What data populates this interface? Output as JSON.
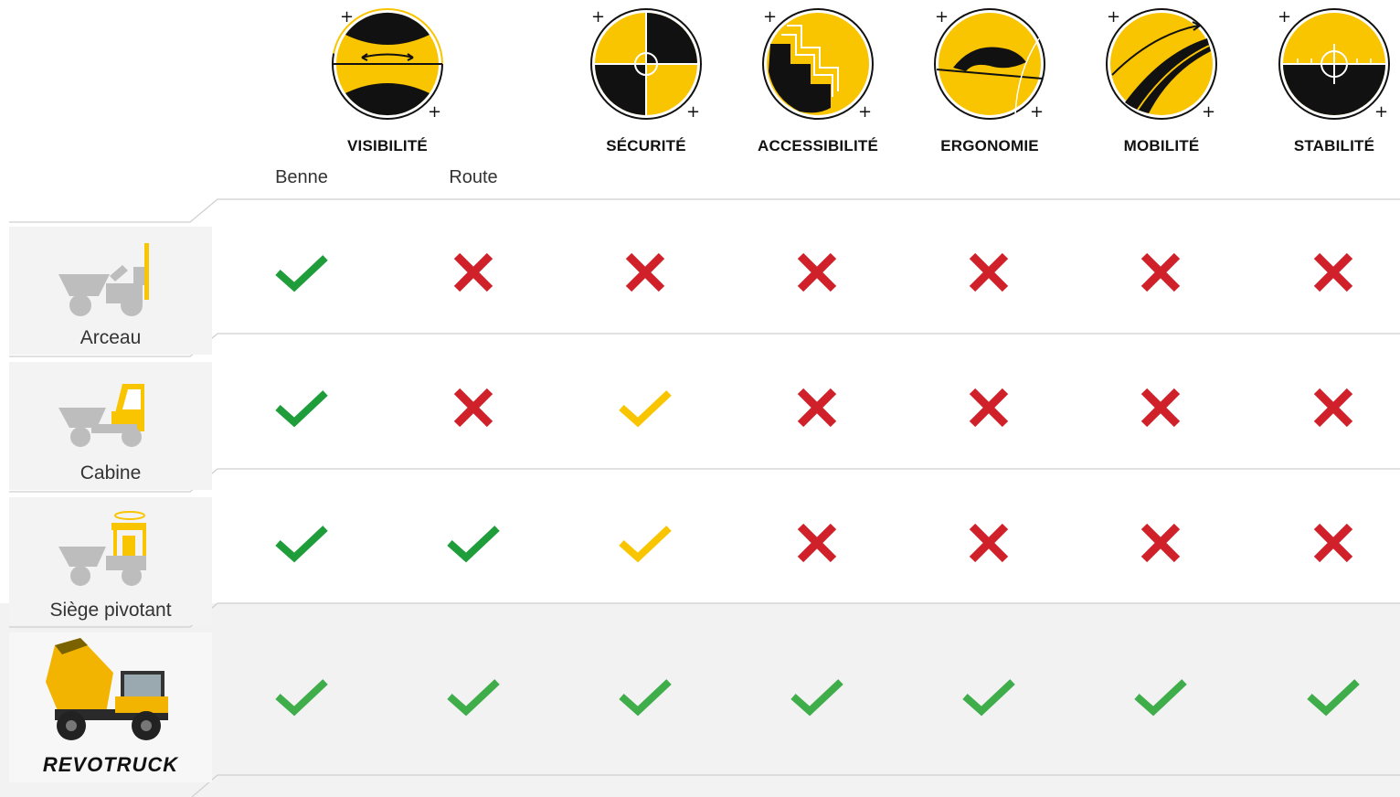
{
  "criteria": [
    {
      "key": "visibility",
      "label": "VISIBILITÉ",
      "icon": "visibility-icon"
    },
    {
      "key": "safety",
      "label": "SÉCURITÉ",
      "icon": "safety-icon"
    },
    {
      "key": "accessibility",
      "label": "ACCESSIBILITÉ",
      "icon": "accessibility-icon"
    },
    {
      "key": "ergonomics",
      "label": "ERGONOMIE",
      "icon": "ergonomics-icon"
    },
    {
      "key": "mobility",
      "label": "MOBILITÉ",
      "icon": "mobility-icon"
    },
    {
      "key": "stability",
      "label": "STABILITÉ",
      "icon": "stability-icon"
    }
  ],
  "visibility_sub": {
    "benne": "Benne",
    "route": "Route"
  },
  "rows": [
    {
      "name": "Arceau",
      "icon": "dumper-rollbar-icon",
      "marks": [
        "check-green",
        "cross",
        "cross",
        "cross",
        "cross",
        "cross",
        "cross"
      ]
    },
    {
      "name": "Cabine",
      "icon": "dumper-cab-icon",
      "marks": [
        "check-green",
        "cross",
        "check-yellow",
        "cross",
        "cross",
        "cross",
        "cross"
      ]
    },
    {
      "name": "Siège pivotant",
      "icon": "dumper-swivel-seat-icon",
      "marks": [
        "check-green",
        "check-green",
        "check-yellow",
        "cross",
        "cross",
        "cross",
        "cross"
      ]
    },
    {
      "name": "REVOTRUCK",
      "icon": "revotruck-photo",
      "marks": [
        "check-green",
        "check-green",
        "check-green",
        "check-green",
        "check-green",
        "check-green",
        "check-green"
      ]
    }
  ],
  "colors": {
    "yellow": "#f9c400",
    "green": "#1f9d3a",
    "green_light": "#3fae4a",
    "red": "#d0212a",
    "black": "#111111"
  }
}
